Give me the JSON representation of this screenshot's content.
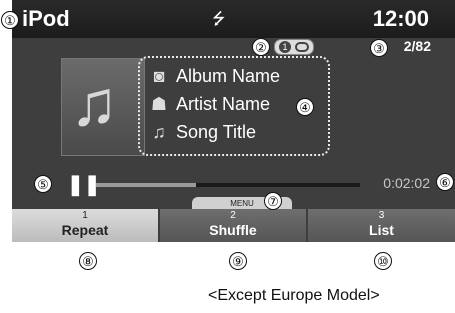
{
  "status_bar": {
    "source": "iPod",
    "clock": "12:00",
    "usb_icon": "usb-icon"
  },
  "playback": {
    "mode_icon": "repeat-icon",
    "track_count": "2/82",
    "elapsed": "0:02:02",
    "progress_fraction": 0.38
  },
  "track": {
    "album": "Album Name",
    "artist": "Artist Name",
    "song": "Song Title"
  },
  "menu": {
    "tab_label": "MENU"
  },
  "softkeys": [
    {
      "number": "1",
      "label": "Repeat"
    },
    {
      "number": "2",
      "label": "Shuffle"
    },
    {
      "number": "3",
      "label": "List"
    }
  ],
  "callouts": [
    "①",
    "②",
    "③",
    "④",
    "⑤",
    "⑥",
    "⑦",
    "⑧",
    "⑨",
    "⑩"
  ],
  "footnote": "<Except Europe Model>"
}
